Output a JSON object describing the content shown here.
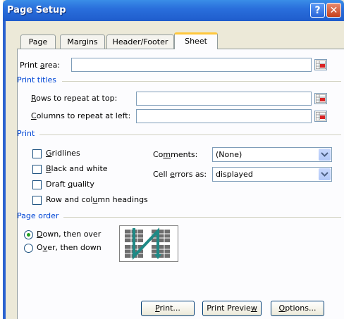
{
  "window": {
    "title": "Page Setup",
    "help_label": "?",
    "close_label": "✕"
  },
  "tabs": [
    {
      "label": "Page",
      "active": false
    },
    {
      "label": "Margins",
      "active": false
    },
    {
      "label": "Header/Footer",
      "active": false
    },
    {
      "label": "Sheet",
      "active": true
    }
  ],
  "sheet": {
    "print_area": {
      "prefix": "Print ",
      "accel": "a",
      "suffix": "rea:",
      "value": ""
    },
    "print_titles": {
      "heading": "Print titles",
      "rows": {
        "prefix": "",
        "accel": "R",
        "suffix": "ows to repeat at top:",
        "value": ""
      },
      "columns": {
        "prefix": "",
        "accel": "C",
        "suffix": "olumns to repeat at left:",
        "value": ""
      }
    },
    "print": {
      "heading": "Print",
      "gridlines": {
        "prefix": "",
        "accel": "G",
        "suffix": "ridlines",
        "checked": false
      },
      "black_white": {
        "prefix": "",
        "accel": "B",
        "suffix": "lack and white",
        "checked": false
      },
      "draft": {
        "prefix": "Draft ",
        "accel": "q",
        "suffix": "uality",
        "checked": false
      },
      "headings": {
        "prefix": "Row and col",
        "accel": "u",
        "suffix": "mn headings",
        "checked": false
      },
      "comments": {
        "prefix": "Co",
        "accel": "m",
        "suffix": "ments:",
        "value": "(None)"
      },
      "cell_errors": {
        "prefix": "Cell ",
        "accel": "e",
        "suffix": "rrors as:",
        "value": "displayed"
      }
    },
    "page_order": {
      "heading": "Page order",
      "down_over": {
        "prefix": "",
        "accel": "D",
        "suffix": "own, then over",
        "selected": true
      },
      "over_down": {
        "prefix": "O",
        "accel": "v",
        "suffix": "er, then down",
        "selected": false
      }
    }
  },
  "buttons": {
    "print": {
      "prefix": "",
      "accel": "P",
      "suffix": "rint..."
    },
    "preview": {
      "prefix": "Print Previe",
      "accel": "w",
      "suffix": ""
    },
    "options": {
      "prefix": "",
      "accel": "O",
      "suffix": "ptions..."
    }
  },
  "icons": {
    "ref_button": "range-selector-icon",
    "dropdown": "chevron-down-icon",
    "page_order_preview": "page-order-preview-icon"
  }
}
